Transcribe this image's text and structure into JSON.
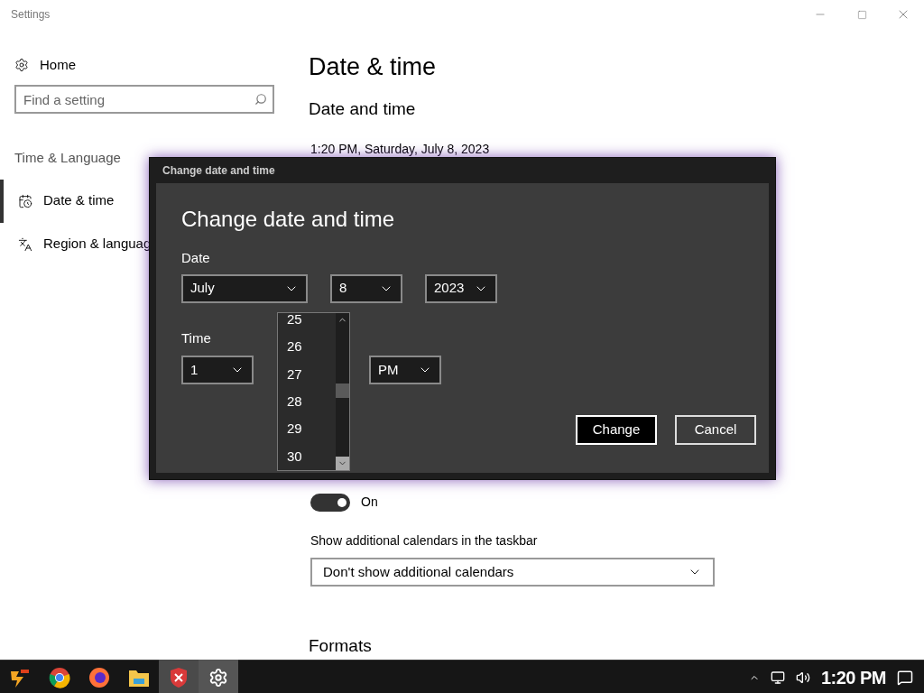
{
  "window": {
    "title": "Settings"
  },
  "sidebar": {
    "home": "Home",
    "search": {
      "placeholder": "Find a setting"
    },
    "section": "Time & Language",
    "items": [
      {
        "label": "Date & time",
        "kind": "calendar",
        "selected": true
      },
      {
        "label": "Region & languag",
        "kind": "language",
        "selected": false
      }
    ]
  },
  "main": {
    "title": "Date & time",
    "section": "Date and time",
    "current": "1:20 PM, Saturday, July 8, 2023",
    "toggle": {
      "on": true,
      "label": "On"
    },
    "calendars": {
      "label": "Show additional calendars in the taskbar",
      "value": "Don't show additional calendars"
    },
    "formats": "Formats"
  },
  "dialog": {
    "title": "Change date and time",
    "heading": "Change date and time",
    "date_label": "Date",
    "date_fields": [
      {
        "value": "July"
      },
      {
        "value": "8"
      },
      {
        "value": "2023"
      }
    ],
    "time_label": "Time",
    "hour": {
      "value": "1"
    },
    "ampm": {
      "value": "PM"
    },
    "minute_list": {
      "items": [
        "25",
        "26",
        "27",
        "28",
        "29",
        "30"
      ],
      "level": 0.5
    },
    "buttons": [
      {
        "label": "Change",
        "kind": "primary"
      },
      {
        "label": "Cancel",
        "kind": "secondary"
      }
    ]
  },
  "taskbar": {
    "clock": "1:20 PM",
    "apps": [
      {
        "kind": "logo"
      },
      {
        "kind": "chrome"
      },
      {
        "kind": "firefox"
      },
      {
        "kind": "folder"
      },
      {
        "kind": "shield"
      },
      {
        "kind": "settings"
      }
    ]
  }
}
